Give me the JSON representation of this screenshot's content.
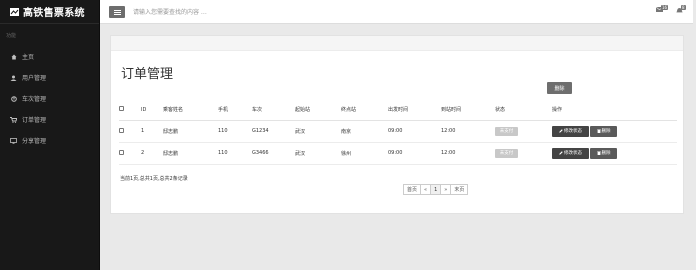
{
  "sidebar": {
    "brand": "高铁售票系统",
    "section_label": "功能",
    "items": [
      {
        "label": "主页",
        "icon": "home-icon"
      },
      {
        "label": "用户管理",
        "icon": "user-icon"
      },
      {
        "label": "车次管理",
        "icon": "train-icon"
      },
      {
        "label": "订单管理",
        "icon": "cart-icon"
      },
      {
        "label": "分享管理",
        "icon": "share-icon"
      }
    ]
  },
  "topbar": {
    "search_placeholder": "请输入您需要查找的内容 …",
    "messages_badge": "16",
    "notifications_badge": "8"
  },
  "main": {
    "title": "订单管理",
    "delete_label": "删除",
    "columns": [
      "ID",
      "乘客姓名",
      "手机",
      "车次",
      "起始站",
      "终点站",
      "出发时间",
      "到站时间",
      "状态",
      "操作"
    ],
    "rows": [
      {
        "id": "1",
        "name": "邸志鹏",
        "phone": "110",
        "train": "G1234",
        "from": "武汉",
        "to": "南京",
        "depart": "09:00",
        "arrive": "12:00",
        "status": "未支付",
        "edit": "修改状态",
        "delete": "删除"
      },
      {
        "id": "2",
        "name": "邸志鹏",
        "phone": "110",
        "train": "G3466",
        "from": "武汉",
        "to": "徐州",
        "depart": "09:00",
        "arrive": "12:00",
        "status": "未支付",
        "edit": "修改状态",
        "delete": "删除"
      }
    ],
    "summary": "当前1页,总共1页,总共2条记录",
    "pagination": [
      "首页",
      "«",
      "1",
      "»",
      "末页"
    ]
  },
  "colors": {
    "sidebar_bg": "#181818",
    "accent": "#444444"
  }
}
